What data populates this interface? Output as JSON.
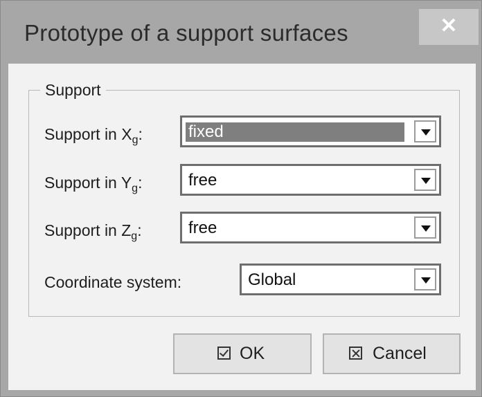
{
  "window": {
    "title": "Prototype of a support surfaces",
    "close_glyph": "✕"
  },
  "support_group": {
    "label": "Support",
    "rows": [
      {
        "label": "Support in X",
        "subscript": "g",
        "suffix": ":",
        "value": "fixed"
      },
      {
        "label": "Support in Y",
        "subscript": "g",
        "suffix": ":",
        "value": "free"
      },
      {
        "label": "Support in Z",
        "subscript": "g",
        "suffix": ":",
        "value": "free"
      }
    ],
    "coordinate_system": {
      "label": "Coordinate system:",
      "value": "Global"
    }
  },
  "buttons": {
    "ok_label": "OK",
    "cancel_label": "Cancel"
  },
  "icons": {
    "ok": "checkbox-check-icon",
    "cancel": "checkbox-x-icon",
    "dropdown": "chevron-down-icon"
  }
}
